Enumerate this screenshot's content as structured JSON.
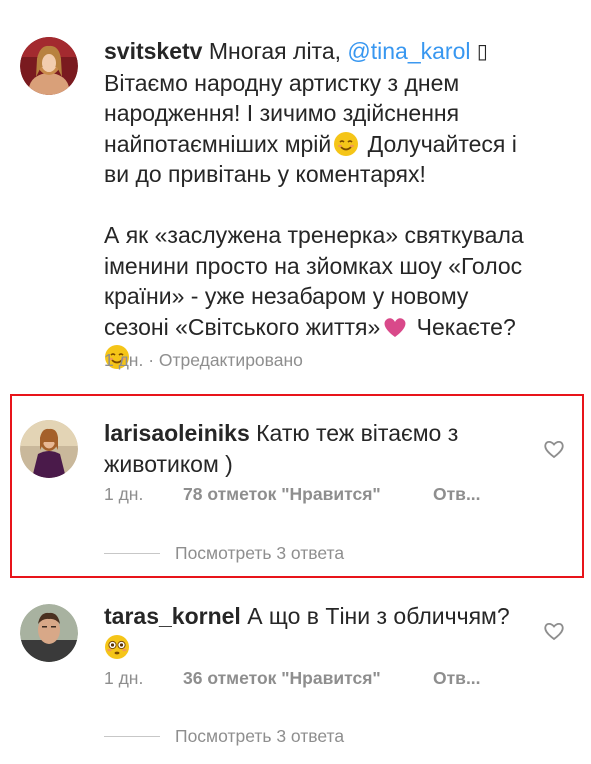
{
  "post_caption": {
    "username": "svitsketv",
    "line1_prefix": " Многая літа, ",
    "mention": "@tina_karol",
    "glyph": "▯",
    "line2": "Вітаємо народну артистку з днем",
    "line3": "народження! І зичимо здійснення",
    "line4_before_emoji": "найпотаємніших мрій",
    "line4_after_emoji": " Долучайтеся і",
    "line5": "ви до привітань у коментарях!",
    "line6": "А як «заслужена тренерка» святкувала",
    "line7": "іменини просто на зйомках шоу «Голос",
    "line8": "країни» - уже незабаром у новому",
    "line9_before_heart": "сезоні «Світського життя»",
    "line9_after_heart": " Чекаєте?",
    "meta_time": "1 дн.",
    "meta_separator": " · ",
    "meta_edited": "Отредактировано"
  },
  "comments": [
    {
      "username": "larisaoleiniks",
      "text_line1": " Катю теж вітаємо з",
      "text_line2": "животиком )",
      "time": "1 дн.",
      "likes": "78 отметок \"Нравится\"",
      "reply": "Отв...",
      "view_replies": "Посмотреть 3 ответа"
    },
    {
      "username": "taras_kornel",
      "text_line1": " А що в Тіни з обличчям?",
      "time": "1 дн.",
      "likes": "36 отметок \"Нравится\"",
      "reply": "Отв...",
      "view_replies": "Посмотреть 3 ответа"
    }
  ],
  "colors": {
    "text": "#262626",
    "secondary": "#8e8e8e",
    "mention": "#3897f0",
    "highlight_border": "#e8141a",
    "heart_emoji": "#d9498a",
    "smile_emoji": "#f5c518"
  },
  "icons": [
    "avatar-svitsketv",
    "avatar-larisaoleiniks",
    "avatar-taras-kornel",
    "smiling-face-emoji",
    "pink-heart-emoji",
    "flushed-face-emoji",
    "heart-outline-icon"
  ]
}
